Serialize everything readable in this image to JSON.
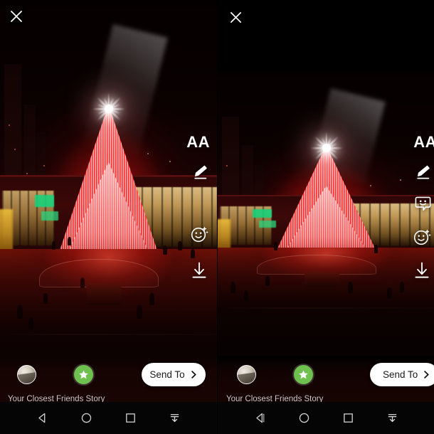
{
  "screen": {
    "kind": "story-share-screen",
    "panels": [
      {
        "id": "left",
        "close_icon": "close-x-icon",
        "photo": {
          "alt": "Large illuminated red Christmas tree with a bright white star on top in a night city plaza",
          "fit": "fill",
          "letterboxed": false
        },
        "tools": [
          {
            "icon": "text-aa-icon",
            "label": "AA"
          },
          {
            "icon": "draw-marker-icon",
            "label": ""
          },
          {
            "icon": "sparkle-smiley-icon",
            "label": ""
          },
          {
            "icon": "download-icon",
            "label": ""
          }
        ],
        "destinations": [
          {
            "icon": "your-story-avatar",
            "label": "Your Story"
          },
          {
            "icon": "closest-friends-star-icon",
            "label": "Closest Friends Story",
            "color": "#6ec14f"
          }
        ],
        "combined_label": "Your Closest Friends Story",
        "send_to": {
          "label": "Send To",
          "icon": "chevron-right-icon"
        }
      },
      {
        "id": "right",
        "close_icon": "close-x-icon",
        "photo": {
          "alt": "Same red Christmas tree photo shown smaller and letterboxed with black bars above and below",
          "fit": "contain",
          "letterboxed": true
        },
        "tools": [
          {
            "icon": "text-aa-icon",
            "label": "AA"
          },
          {
            "icon": "draw-marker-icon",
            "label": ""
          },
          {
            "icon": "sticker-icon",
            "label": ""
          },
          {
            "icon": "sparkle-smiley-icon",
            "label": ""
          },
          {
            "icon": "download-icon",
            "label": ""
          }
        ],
        "destinations": [
          {
            "icon": "your-story-avatar",
            "label": "Your Story"
          },
          {
            "icon": "closest-friends-star-icon",
            "label": "Closest Friends Story",
            "color": "#6ec14f"
          }
        ],
        "combined_label": "Your Closest Friends Story",
        "send_to": {
          "label": "Send To",
          "icon": "chevron-right-icon"
        }
      }
    ],
    "navbar": {
      "items": [
        {
          "icon": "back-triangle-icon"
        },
        {
          "icon": "home-circle-icon"
        },
        {
          "icon": "recents-square-icon"
        },
        {
          "icon": "hide-navbar-down-icon"
        }
      ]
    },
    "colors": {
      "accent_green": "#6ec14f",
      "send_button_bg": "#ffffff",
      "send_button_text": "#1a1a1a",
      "label_text": "#cfc8c6",
      "navbar_bg": "#050505",
      "tree_red": "#ff2020"
    }
  }
}
